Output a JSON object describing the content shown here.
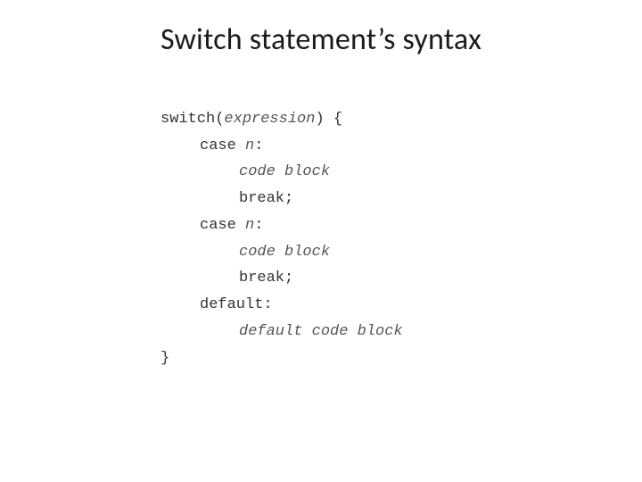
{
  "title": "Switch statement’s syntax",
  "code": {
    "l1_kw": "switch(",
    "l1_expr": "expression",
    "l1_end": ") {",
    "l2_kw": "case ",
    "l2_expr": "n",
    "l2_end": ":",
    "l3_expr": "code block",
    "l4_kw": "break;",
    "l5_kw": "case ",
    "l5_expr": "n",
    "l5_end": ":",
    "l6_expr": "code block",
    "l7_kw": "break;",
    "l8_kw": "default:",
    "l9_expr": "default code block",
    "l10_kw": "}"
  }
}
